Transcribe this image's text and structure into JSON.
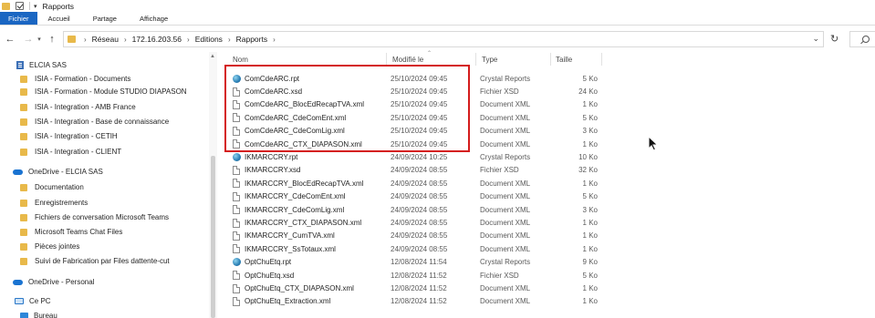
{
  "window": {
    "title": "Rapports"
  },
  "ribbon": {
    "tabs": [
      "Fichier",
      "Accueil",
      "Partage",
      "Affichage"
    ],
    "active": "Fichier"
  },
  "address": {
    "crumbs": [
      "Réseau",
      "172.16.203.56",
      "Editions",
      "Rapports"
    ]
  },
  "sidebar": {
    "items": [
      {
        "label": "ELCIA SAS",
        "icon": "building-icon"
      },
      {
        "label": "ISIA - Formation - Documents",
        "icon": "folder-icon"
      },
      {
        "label": "ISIA - Formation - Module STUDIO DIAPASON",
        "icon": "folder-icon"
      },
      {
        "label": "ISIA - Integration - AMB France",
        "icon": "folder-icon"
      },
      {
        "label": "ISIA - Integration - Base de connaissance",
        "icon": "folder-icon"
      },
      {
        "label": "ISIA - Integration - CETIH",
        "icon": "folder-icon"
      },
      {
        "label": "ISIA - Integration - CLIENT",
        "icon": "folder-icon"
      },
      {
        "label": "OneDrive - ELCIA SAS",
        "icon": "cloud-icon"
      },
      {
        "label": "Documentation",
        "icon": "folder-icon"
      },
      {
        "label": "Enregistrements",
        "icon": "folder-icon"
      },
      {
        "label": "Fichiers de conversation Microsoft Teams",
        "icon": "folder-icon"
      },
      {
        "label": "Microsoft Teams Chat Files",
        "icon": "folder-icon"
      },
      {
        "label": "Pièces jointes",
        "icon": "folder-icon"
      },
      {
        "label": "Suivi de Fabrication par Files dattente-cut",
        "icon": "folder-icon"
      },
      {
        "label": "OneDrive - Personal",
        "icon": "cloud-icon"
      },
      {
        "label": "Ce PC",
        "icon": "pc-icon"
      },
      {
        "label": "Bureau",
        "icon": "desktop-icon"
      }
    ]
  },
  "columns": {
    "name": "Nom",
    "modified": "Modifié le",
    "type": "Type",
    "size": "Taille"
  },
  "files": [
    {
      "name": "ComCdeARC.rpt",
      "modified": "25/10/2024 09:45",
      "type": "Crystal Reports",
      "size": "5 Ko",
      "icon": "crystal-reports-icon"
    },
    {
      "name": "ComCdeARC.xsd",
      "modified": "25/10/2024 09:45",
      "type": "Fichier XSD",
      "size": "24 Ko",
      "icon": "document-icon"
    },
    {
      "name": "ComCdeARC_BlocEdRecapTVA.xml",
      "modified": "25/10/2024 09:45",
      "type": "Document XML",
      "size": "1 Ko",
      "icon": "document-icon"
    },
    {
      "name": "ComCdeARC_CdeComEnt.xml",
      "modified": "25/10/2024 09:45",
      "type": "Document XML",
      "size": "5 Ko",
      "icon": "document-icon"
    },
    {
      "name": "ComCdeARC_CdeComLig.xml",
      "modified": "25/10/2024 09:45",
      "type": "Document XML",
      "size": "3 Ko",
      "icon": "document-icon"
    },
    {
      "name": "ComCdeARC_CTX_DIAPASON.xml",
      "modified": "25/10/2024 09:45",
      "type": "Document XML",
      "size": "1 Ko",
      "icon": "document-icon"
    },
    {
      "name": "IKMARCCRY.rpt",
      "modified": "24/09/2024 10:25",
      "type": "Crystal Reports",
      "size": "10 Ko",
      "icon": "crystal-reports-icon"
    },
    {
      "name": "IKMARCCRY.xsd",
      "modified": "24/09/2024 08:55",
      "type": "Fichier XSD",
      "size": "32 Ko",
      "icon": "document-icon"
    },
    {
      "name": "IKMARCCRY_BlocEdRecapTVA.xml",
      "modified": "24/09/2024 08:55",
      "type": "Document XML",
      "size": "1 Ko",
      "icon": "document-icon"
    },
    {
      "name": "IKMARCCRY_CdeComEnt.xml",
      "modified": "24/09/2024 08:55",
      "type": "Document XML",
      "size": "5 Ko",
      "icon": "document-icon"
    },
    {
      "name": "IKMARCCRY_CdeComLig.xml",
      "modified": "24/09/2024 08:55",
      "type": "Document XML",
      "size": "3 Ko",
      "icon": "document-icon"
    },
    {
      "name": "IKMARCCRY_CTX_DIAPASON.xml",
      "modified": "24/09/2024 08:55",
      "type": "Document XML",
      "size": "1 Ko",
      "icon": "document-icon"
    },
    {
      "name": "IKMARCCRY_CumTVA.xml",
      "modified": "24/09/2024 08:55",
      "type": "Document XML",
      "size": "1 Ko",
      "icon": "document-icon"
    },
    {
      "name": "IKMARCCRY_SsTotaux.xml",
      "modified": "24/09/2024 08:55",
      "type": "Document XML",
      "size": "1 Ko",
      "icon": "document-icon"
    },
    {
      "name": "OptChuEtq.rpt",
      "modified": "12/08/2024 11:54",
      "type": "Crystal Reports",
      "size": "9 Ko",
      "icon": "crystal-reports-icon"
    },
    {
      "name": "OptChuEtq.xsd",
      "modified": "12/08/2024 11:52",
      "type": "Fichier XSD",
      "size": "5 Ko",
      "icon": "document-icon"
    },
    {
      "name": "OptChuEtq_CTX_DIAPASON.xml",
      "modified": "12/08/2024 11:52",
      "type": "Document XML",
      "size": "1 Ko",
      "icon": "document-icon"
    },
    {
      "name": "OptChuEtq_Extraction.xml",
      "modified": "12/08/2024 11:52",
      "type": "Document XML",
      "size": "1 Ko",
      "icon": "document-icon"
    }
  ],
  "colors": {
    "accent": "#1a66c2",
    "highlight_border": "#d41c1c",
    "folder": "#e8b94a"
  }
}
